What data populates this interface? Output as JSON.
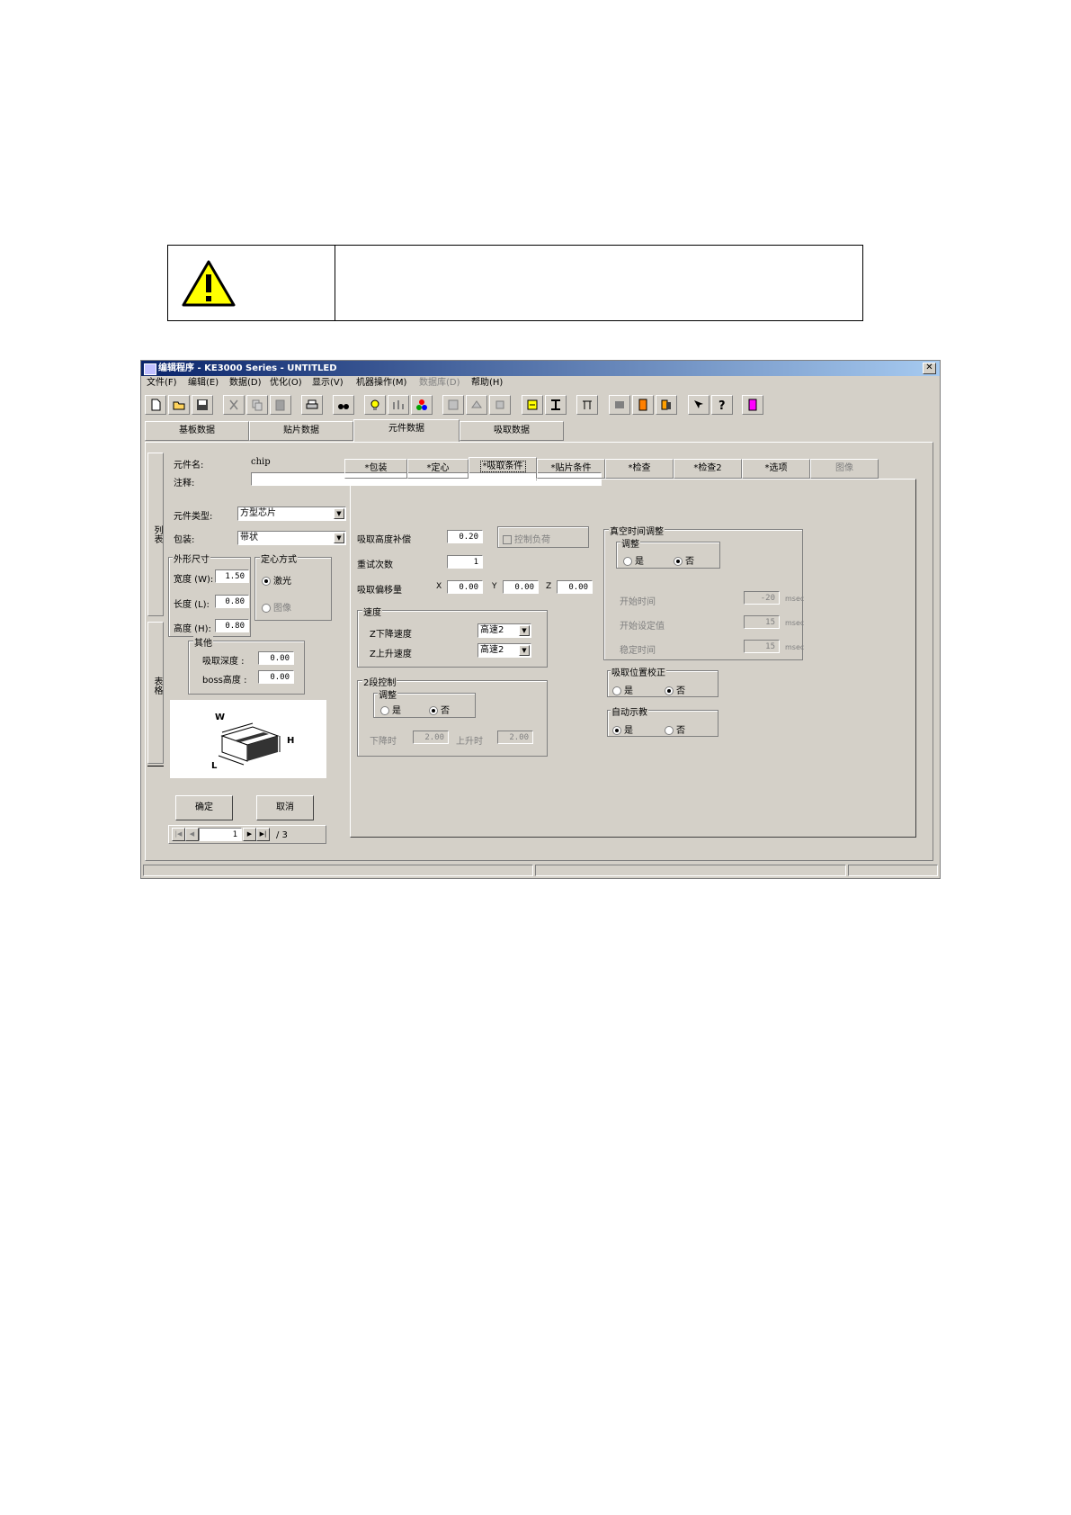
{
  "window": {
    "title": "编辑程序 - KE3000 Series - UNTITLED",
    "close_label": "✕"
  },
  "menu": [
    "文件(F)",
    "编辑(E)",
    "数据(D)",
    "优化(O)",
    "显示(V)",
    "机器操作(M)",
    "数据库(D)",
    "帮助(H)"
  ],
  "main_tabs": [
    "基板数据",
    "贴片数据",
    "元件数据",
    "吸取数据"
  ],
  "side_tabs": [
    "列表",
    "表格"
  ],
  "part": {
    "name_label": "元件名:",
    "name_value": "chip",
    "comment_label": "注释:",
    "comment_value": "",
    "type_label": "元件类型:",
    "type_value": "方型芯片",
    "package_label": "包装:",
    "package_value": "带状"
  },
  "size_group": {
    "title": "外形尺寸",
    "width_label": "宽度 (W):",
    "width_value": "1.50",
    "length_label": "长度 (L):",
    "length_value": "0.80",
    "height_label": "高度 (H):",
    "height_value": "0.80"
  },
  "center_group": {
    "title": "定心方式",
    "laser_label": "激光",
    "image_label": "图像"
  },
  "other_group": {
    "title": "其他",
    "pick_depth_label": "吸取深度 :",
    "pick_depth_value": "0.00",
    "boss_label": "boss高度 :",
    "boss_value": "0.00"
  },
  "diagram_labels": {
    "w": "W",
    "h": "H",
    "l": "L"
  },
  "buttons": {
    "ok": "确定",
    "cancel": "取消"
  },
  "nav": {
    "page": "1",
    "total": "/ 3"
  },
  "sub_tabs": [
    "*包装",
    "*定心",
    "*吸取条件",
    "*贴片条件",
    "*检查",
    "*检查2",
    "*选项",
    "图像"
  ],
  "pick": {
    "height_comp_label": "吸取高度补偿",
    "height_comp_value": "0.20",
    "control_load_label": "控制负荷",
    "retry_label": "重试次数",
    "retry_value": "1",
    "offset_label": "吸取偏移量",
    "x_label": "X",
    "x_value": "0.00",
    "y_label": "Y",
    "y_value": "0.00",
    "z_label": "Z",
    "z_value": "0.00"
  },
  "speed_group": {
    "title": "速度",
    "down_label": "Z下降速度",
    "down_value": "高速2",
    "up_label": "Z上升速度",
    "up_value": "高速2"
  },
  "stage_group": {
    "title": "2段控制",
    "adjust_title": "调整",
    "yes_label": "是",
    "no_label": "否",
    "down_label": "下降时",
    "down_value": "2.00",
    "up_label": "上升时",
    "up_value": "2.00"
  },
  "vacuum_group": {
    "title": "真空时间调整",
    "adjust_title": "调整",
    "yes_label": "是",
    "no_label": "否",
    "start_label": "开始时间",
    "start_value": "-20",
    "threshold_label": "开始设定值",
    "threshold_value": "15",
    "stable_label": "稳定时间",
    "stable_value": "15",
    "unit": "msec"
  },
  "pos_correct_group": {
    "title": "吸取位置校正",
    "yes_label": "是",
    "no_label": "否"
  },
  "auto_teach_group": {
    "title": "自动示教",
    "yes_label": "是",
    "no_label": "否"
  }
}
